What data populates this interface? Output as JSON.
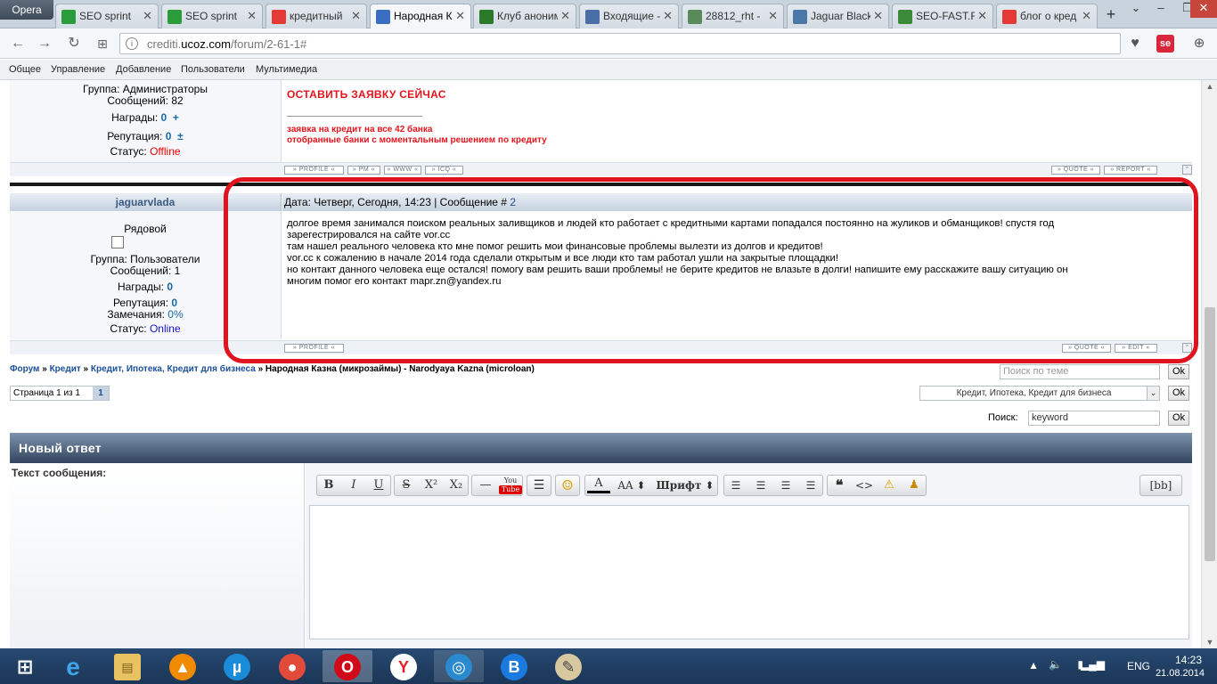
{
  "browser": {
    "menu_label": "Opera",
    "tabs": [
      {
        "title": "SEO sprint",
        "icon": "seo-sprint-icon",
        "color": "#2a9d3a"
      },
      {
        "title": "SEO sprint",
        "icon": "seo-sprint-icon",
        "color": "#2a9d3a"
      },
      {
        "title": "кредитный",
        "icon": "yandex-icon",
        "color": "#e53935"
      },
      {
        "title": "Народная К",
        "icon": "ucoz-icon",
        "color": "#3a6ec0",
        "active": true
      },
      {
        "title": "Клуб аноним",
        "icon": "club-icon",
        "color": "#2a7a2a"
      },
      {
        "title": "Входящие -",
        "icon": "mail-icon",
        "color": "#4a6ea8"
      },
      {
        "title": "28812_rht -",
        "icon": "image-icon",
        "color": "#5a8a5a"
      },
      {
        "title": "Jaguar Black",
        "icon": "vk-icon",
        "color": "#4a76a8"
      },
      {
        "title": "SEO-FAST.R",
        "icon": "seo-fast-icon",
        "color": "#3a8a3a"
      },
      {
        "title": "блог о кред",
        "icon": "yandex-icon",
        "color": "#e53935"
      }
    ],
    "url_host_prefix": "crediti.",
    "url_host": "ucoz.com",
    "url_path": "/forum/2-61-1#"
  },
  "admin_menu": [
    "Общее",
    "Управление",
    "Добавление",
    "Пользователи",
    "Мультимедиа"
  ],
  "post1": {
    "group_label": "Группа: Администраторы",
    "messages_label": "Сообщений: 82",
    "awards_label": "Награды:",
    "awards_value": "0",
    "awards_plus": "+",
    "rep_label": "Репутация:",
    "rep_value": "0",
    "rep_pm": "±",
    "status_label": "Статус:",
    "status_value": "Offline",
    "cta": "ОСТАВИТЬ ЗАЯВКУ СЕЙЧАС",
    "line1": "заявка на кредит на все 42 банка",
    "line2": "отобранные банки с моментальным решением по кредиту",
    "buttons_left": [
      "PROFILE",
      "PM",
      "WWW",
      "ICQ"
    ],
    "buttons_right": [
      "QUOTE",
      "REPORT"
    ]
  },
  "post2": {
    "author": "jaguarvlada",
    "header_text": "Дата: Четверг, Сегодня, 14:23 | Сообщение #",
    "header_num": "2",
    "rank": "Рядовой",
    "group_label": "Группа: Пользователи",
    "messages_label": "Сообщений: 1",
    "awards_label": "Награды:",
    "awards_value": "0",
    "rep_label": "Репутация:",
    "rep_value": "0",
    "warn_label": "Замечания:",
    "warn_value": "0%",
    "status_label": "Статус:",
    "status_value": "Online",
    "text_lines": [
      "долгое время занимался поиском реальных заливщиков и людей кто работает с кредитными картами попадался постоянно на жуликов и обманщиков! спустя год",
      "зарегестрировался на сайте vor.cc",
      "там нашел реального человека кто мне помог решить мои финансовые проблемы вылезти из долгов и кредитов!",
      "vor.cc к сожалению в начале 2014 года сделали открытым и все люди кто там работал ушли на закрытые площадки!",
      "но контакт данного человека еще остался! помогу вам решить ваши проблемы! не берите кредитов не влазьте в долги! напишите ему расскажите вашу ситуацию он",
      "многим помог его контакт mapr.zn@yandex.ru"
    ],
    "buttons_left": [
      "PROFILE"
    ],
    "buttons_right": [
      "QUOTE",
      "EDIT"
    ]
  },
  "breadcrumb": {
    "items": [
      "Форум",
      "Кредит",
      "Кредит, Ипотека, Кредит для бизнеса"
    ],
    "separator": "»",
    "current": "Народная Казна (микрозаймы) - Narodyaya Kazna (microloan)"
  },
  "topic_search_placeholder": "Поиск по теме",
  "ok_label": "Ok",
  "pages_label": "Страница 1 из 1",
  "page_current": "1",
  "forum_select": "Кредит, Ипотека, Кредит для бизнеса",
  "search_label": "Поиск:",
  "search_value": "keyword",
  "new_reply_title": "Новый ответ",
  "message_text_label": "Текст сообщения:",
  "editor": {
    "font_label": "Шрифт",
    "bb_label": "[bb]",
    "size_label": "AA"
  },
  "taskbar": {
    "lang": "ENG",
    "time": "14:23",
    "date": "21.08.2014"
  }
}
